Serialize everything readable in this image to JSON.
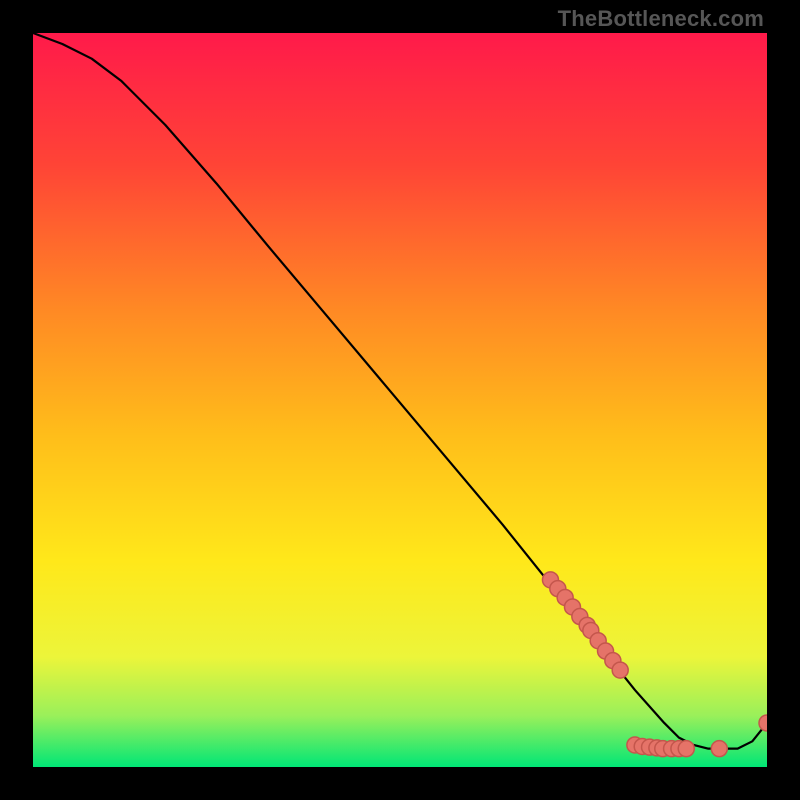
{
  "watermark": "TheBottleneck.com",
  "chart_data": {
    "type": "line",
    "title": "",
    "xlabel": "",
    "ylabel": "",
    "xlim": [
      0,
      100
    ],
    "ylim": [
      0,
      100
    ],
    "grid": false,
    "background_gradient": {
      "top_color": "#ff1a4a",
      "mid_colors": [
        "#ff6a2f",
        "#ffbe1a",
        "#ffe81a",
        "#b7f53c"
      ],
      "bottom_color": "#00e676"
    },
    "curve": {
      "description": "Monotone decreasing bottleneck curve reaching a floor near x≈88 then slight rise at the end",
      "x": [
        0,
        4,
        8,
        12,
        18,
        25,
        32,
        40,
        48,
        56,
        64,
        70,
        74,
        78,
        82,
        86,
        88,
        90,
        92,
        94,
        96,
        98,
        100
      ],
      "y": [
        100,
        98.5,
        96.5,
        93.5,
        87.5,
        79.5,
        71,
        61.5,
        52,
        42.5,
        33,
        25.5,
        20.5,
        15.5,
        10.5,
        6,
        4,
        3,
        2.5,
        2.5,
        2.5,
        3.5,
        6
      ]
    },
    "markers": {
      "description": "Salmon circular markers along the lower portion of the curve",
      "color_fill": "#e57368",
      "color_stroke": "#c4564c",
      "radius_px": 8,
      "points": [
        {
          "x": 70.5,
          "y": 25.5
        },
        {
          "x": 71.5,
          "y": 24.3
        },
        {
          "x": 72.5,
          "y": 23.1
        },
        {
          "x": 73.5,
          "y": 21.8
        },
        {
          "x": 74.5,
          "y": 20.5
        },
        {
          "x": 75.5,
          "y": 19.3
        },
        {
          "x": 76.0,
          "y": 18.6
        },
        {
          "x": 77.0,
          "y": 17.2
        },
        {
          "x": 78.0,
          "y": 15.8
        },
        {
          "x": 79.0,
          "y": 14.5
        },
        {
          "x": 80.0,
          "y": 13.2
        },
        {
          "x": 82.0,
          "y": 3.0
        },
        {
          "x": 83.0,
          "y": 2.8
        },
        {
          "x": 84.0,
          "y": 2.7
        },
        {
          "x": 85.0,
          "y": 2.6
        },
        {
          "x": 85.8,
          "y": 2.5
        },
        {
          "x": 87.0,
          "y": 2.5
        },
        {
          "x": 88.0,
          "y": 2.5
        },
        {
          "x": 89.0,
          "y": 2.5
        },
        {
          "x": 93.5,
          "y": 2.5
        },
        {
          "x": 100.0,
          "y": 6.0
        }
      ]
    }
  }
}
